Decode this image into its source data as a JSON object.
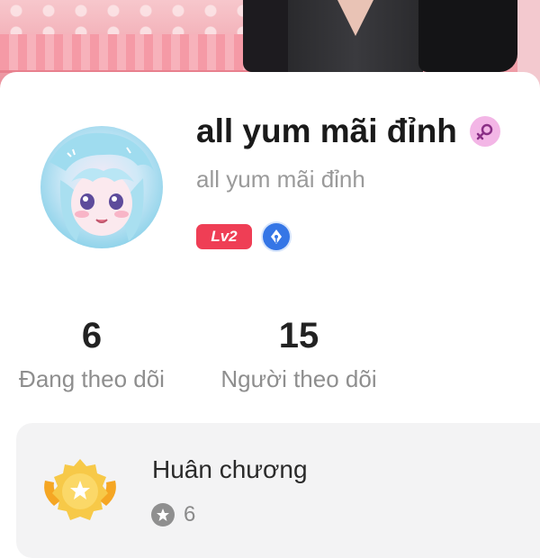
{
  "profile": {
    "display_name": "all yum mãi đỉnh",
    "username": "all yum mãi đỉnh",
    "level": "Lv2",
    "gender_icon": "female-symbol-icon",
    "verified_icon": "pen-nib-icon"
  },
  "stats": {
    "following_count": "6",
    "following_label": "Đang theo dõi",
    "followers_count": "15",
    "followers_label": "Người theo dõi"
  },
  "medals": {
    "title": "Huân chương",
    "count": "6",
    "icon": "gold-medal-icon",
    "count_icon": "star-circle-icon"
  },
  "colors": {
    "level_badge": "#ef3e55",
    "gender_badge": "#f3b6e6",
    "verified_badge": "#3576e6",
    "card_background": "#f3f3f4"
  }
}
